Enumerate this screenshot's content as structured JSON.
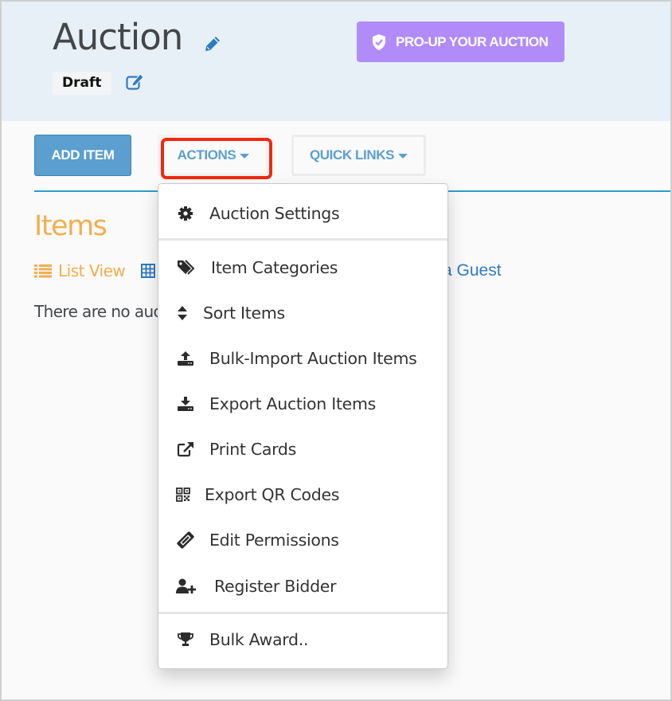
{
  "header": {
    "title": "Auction",
    "status": "Draft",
    "pro_button_label": "PRO-UP YOUR AUCTION"
  },
  "toolbar": {
    "add_item_label": "ADD ITEM",
    "actions_label": "ACTIONS",
    "quick_links_label": "QUICK LINKS"
  },
  "items_section": {
    "heading": "Items",
    "list_view_label": "List View",
    "guest_link_partial": "a Guest",
    "empty_message_partial": "There are no auc"
  },
  "actions_menu": {
    "items": [
      {
        "label": "Auction Settings",
        "icon": "gear-icon"
      },
      {
        "label": "Item Categories",
        "icon": "tags-icon"
      },
      {
        "label": "Sort Items",
        "icon": "sort-icon"
      },
      {
        "label": "Bulk-Import Auction Items",
        "icon": "upload-icon"
      },
      {
        "label": "Export Auction Items",
        "icon": "download-icon"
      },
      {
        "label": "Print Cards",
        "icon": "external-link-icon"
      },
      {
        "label": "Export QR Codes",
        "icon": "qrcode-icon"
      },
      {
        "label": "Edit Permissions",
        "icon": "ticket-icon"
      },
      {
        "label": "Register Bidder",
        "icon": "user-plus-icon"
      },
      {
        "label": "Bulk Award..",
        "icon": "trophy-icon"
      }
    ]
  },
  "colors": {
    "header_bg": "#e8f0f7",
    "pro_button": "#b18bfa",
    "primary_blue": "#5a9fcf",
    "link_blue": "#2f7ac2",
    "items_orange": "#f3ae4e",
    "highlight_red": "#f0290f"
  }
}
